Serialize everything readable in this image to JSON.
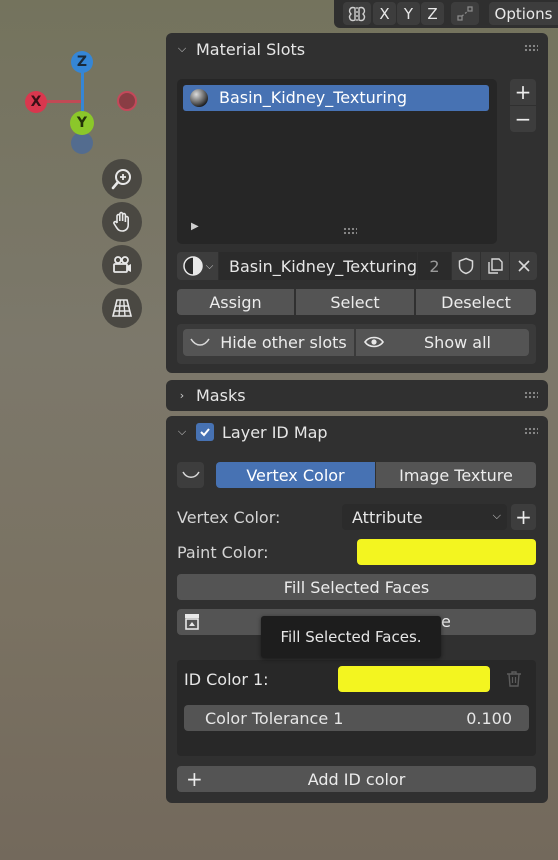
{
  "header": {
    "axis_x": "X",
    "axis_y": "Y",
    "axis_z": "Z",
    "options_label": "Options"
  },
  "gizmo": {
    "z_label": "Z",
    "x_label": "X",
    "y_label": "Y",
    "colors": {
      "x": "#d9374e",
      "y": "#8bc72a",
      "z": "#3586d6"
    }
  },
  "material_slots": {
    "title": "Material Slots",
    "slots": [
      {
        "name": "Basin_Kidney_Texturing",
        "selected": true
      }
    ],
    "material_name": "Basin_Kidney_Texturing",
    "user_count": "2",
    "assign_label": "Assign",
    "select_label": "Select",
    "deselect_label": "Deselect",
    "hide_other_label": "Hide other slots",
    "show_all_label": "Show all"
  },
  "masks": {
    "title": "Masks"
  },
  "layer_id_map": {
    "title": "Layer ID Map",
    "enabled": true,
    "tab_vertex_color": "Vertex Color",
    "tab_image_texture": "Image Texture",
    "active_tab": "Vertex Color",
    "vertex_color_label": "Vertex Color:",
    "vertex_color_value": "Attribute",
    "paint_color_label": "Paint Color:",
    "paint_color": "#f3f520",
    "fill_selected_label": "Fill Selected Faces",
    "hidden_button_suffix": "e",
    "tooltip": "Fill Selected Faces.",
    "id_color_label": "ID Color 1:",
    "id_color": "#f3f520",
    "tolerance_label": "Color Tolerance 1",
    "tolerance_value": "0.100",
    "add_id_label": "Add ID color"
  }
}
